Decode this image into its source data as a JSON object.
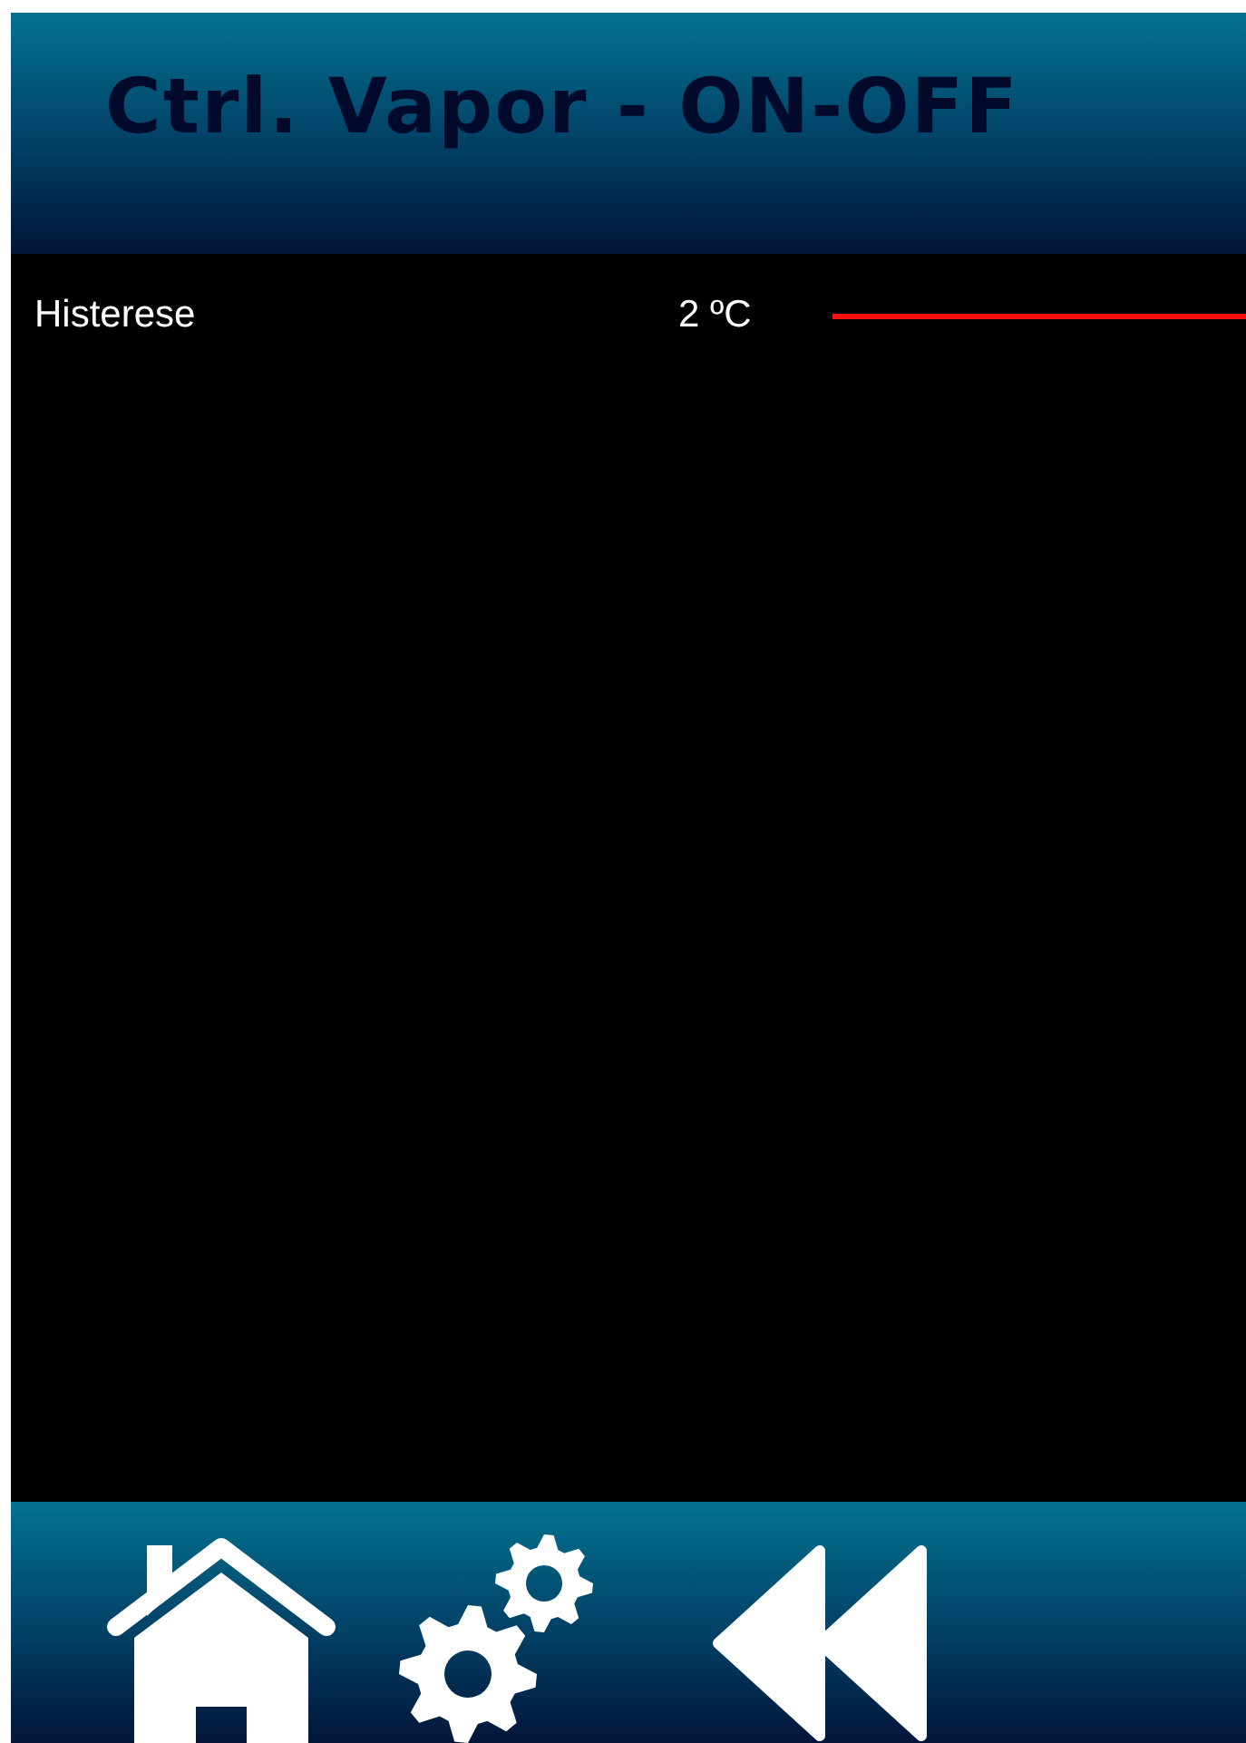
{
  "header": {
    "title": "Ctrl. Vapor - ON-OFF"
  },
  "parameters": [
    {
      "label": "Histerese",
      "value": "2 ºC",
      "kind": "line"
    }
  ],
  "footer": {
    "buttons": [
      {
        "kind": "home"
      },
      {
        "kind": "settings"
      },
      {
        "kind": "back"
      }
    ]
  }
}
